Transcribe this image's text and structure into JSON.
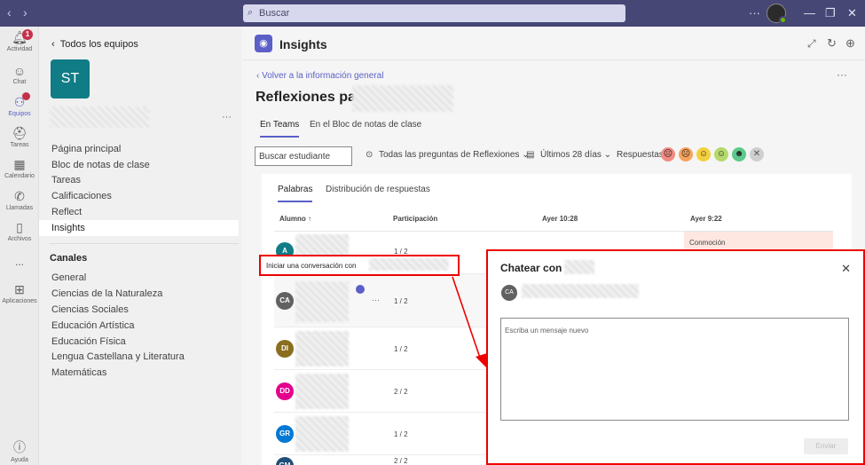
{
  "search": {
    "placeholder": "Buscar"
  },
  "rail": [
    {
      "label": "Actividad",
      "icon": "bell-icon",
      "glyph": "🔔",
      "badge": "1"
    },
    {
      "label": "Chat",
      "icon": "chat-icon",
      "glyph": "💬"
    },
    {
      "label": "Equipos",
      "icon": "teams-icon",
      "glyph": "👥",
      "badge": "•"
    },
    {
      "label": "Tareas",
      "icon": "tasks-icon",
      "glyph": "🎒"
    },
    {
      "label": "Calendario",
      "icon": "calendar-icon",
      "glyph": "📅"
    },
    {
      "label": "Llamadas",
      "icon": "phone-icon",
      "glyph": "📞"
    },
    {
      "label": "Archivos",
      "icon": "file-icon",
      "glyph": "📄"
    },
    {
      "label": "...",
      "icon": "more-icon",
      "glyph": ""
    },
    {
      "label": "Aplicaciones",
      "icon": "apps-icon",
      "glyph": "⊞"
    },
    {
      "label": "Ayuda",
      "icon": "help-icon",
      "glyph": "?"
    }
  ],
  "panel": {
    "back": "Todos los equipos",
    "team_initials": "ST",
    "items": [
      "Página principal",
      "Bloc de notas de clase",
      "Tareas",
      "Calificaciones",
      "Reflect",
      "Insights"
    ],
    "channels_header": "Canales",
    "channels": [
      "General",
      "Ciencias de la Naturaleza",
      "Ciencias Sociales",
      "Educación Artística",
      "Educación Física",
      "Lengua Castellana y Literatura",
      "Matemáticas"
    ]
  },
  "app": {
    "title": "Insights"
  },
  "content": {
    "back": "Volver a la información general",
    "title": "Reflexiones para",
    "tabs": [
      "En Teams",
      "En el Bloc de notas de clase"
    ],
    "search_placeholder": "Buscar estudiante",
    "filter_questions": "Todas las preguntas de Reflexiones",
    "filter_days": "Últimos 28 días",
    "responses_label": "Respuestas:"
  },
  "card": {
    "tabs": [
      "Palabras",
      "Distribución de respuestas"
    ],
    "headers": [
      "Alumno ↑",
      "Participación",
      "Ayer 10:28",
      "Ayer 9:22"
    ],
    "rows": [
      {
        "initials": "A",
        "color": "#0f7c86",
        "part": "1 / 2"
      },
      {
        "initials": "CA",
        "color": "#616161",
        "part": "1 / 2"
      },
      {
        "initials": "DI",
        "color": "#8a6d1d",
        "part": "1 / 2"
      },
      {
        "initials": "DD",
        "color": "#e3008c",
        "part": "2 / 2"
      },
      {
        "initials": "GR",
        "color": "#0078d4",
        "part": "1 / 2"
      },
      {
        "initials": "GM",
        "color": "#1f4e79",
        "part": "2 / 2"
      }
    ],
    "conmocion": "Conmoción"
  },
  "hover_tip": "Iniciar una conversación con",
  "chat": {
    "title": "Chatear con",
    "avatar": "CA",
    "placeholder": "Escriba un mensaje nuevo",
    "send": "Enviar"
  }
}
